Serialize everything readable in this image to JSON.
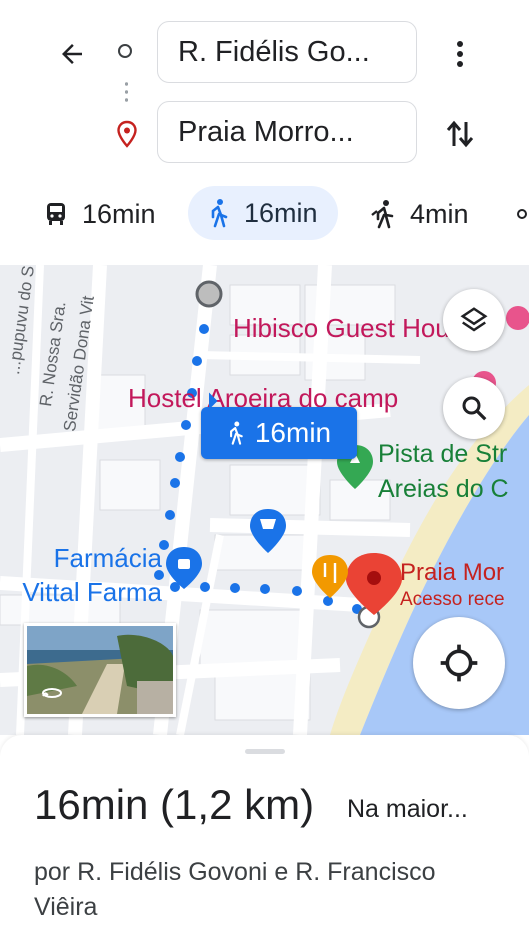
{
  "header": {
    "origin_value": "R. Fidélis Go...",
    "destination_value": "Praia Morro...",
    "modes": [
      {
        "icon": "transit-icon",
        "label": "16min"
      },
      {
        "icon": "walk-icon",
        "label": "16min",
        "selected": true
      },
      {
        "icon": "ride-icon",
        "label": "4min"
      }
    ]
  },
  "map": {
    "places": {
      "hibisco": "Hibisco Guest House",
      "hostel": "Hostel Aroeira do camp",
      "pista_line1": "Pista de Str",
      "pista_line2": "Areias do C",
      "farmacia_line1": "Farmácia",
      "farmacia_line2": "Vittal Farma",
      "praia_title": "Praia Mor",
      "praia_sub": "Acesso rece"
    },
    "streets": [
      "...pupuvu do Sul",
      "R. Nossa Sra.",
      "Servidão Dona Vit"
    ],
    "route_badge": "16min",
    "colors": {
      "route": "#1a73e8",
      "water": "#a8c8f8",
      "sand": "#f5eec8",
      "destination": "#ea4335"
    }
  },
  "sheet": {
    "summary": "16min (1,2 km)",
    "note": "Na maior...",
    "via": "por R. Fidélis Govoni e R. Francisco Viêira"
  }
}
